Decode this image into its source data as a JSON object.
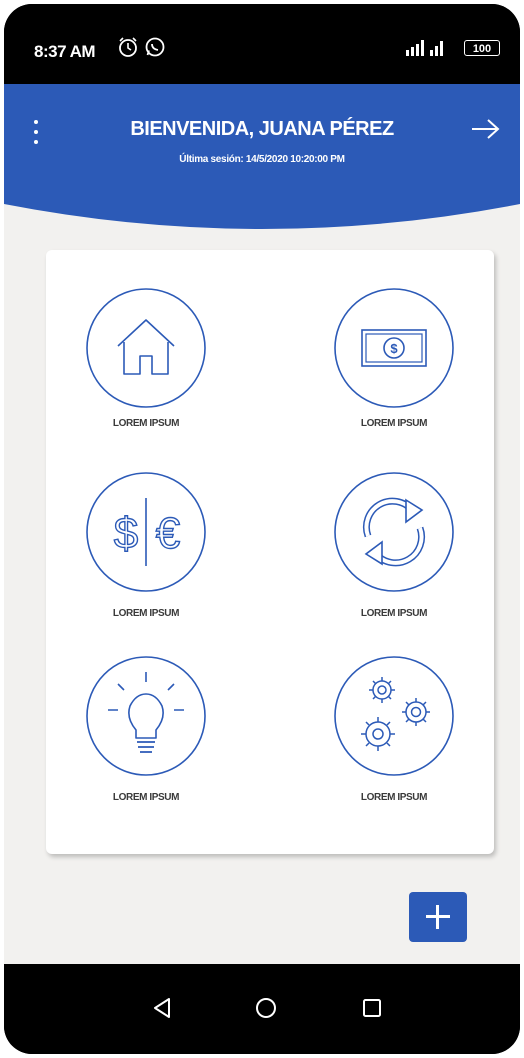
{
  "status_bar": {
    "time": "8:37 AM",
    "battery": "100",
    "icons": [
      "alarm-icon",
      "whatsapp-icon",
      "signal-icon",
      "battery-icon"
    ]
  },
  "header": {
    "title": "BIENVENIDA, JUANA PÉREZ",
    "subtitle": "Última sesión: 14/5/2020 10:20:00 PM",
    "background_color": "#2c5ab7",
    "icons": [
      "more-vert-icon",
      "logout-arrow-icon"
    ]
  },
  "grid": {
    "accent_color": "#2c5ab7",
    "items": [
      {
        "label": "LOREM IPSUM",
        "icon": "home-icon"
      },
      {
        "label": "LOREM IPSUM",
        "icon": "money-bill-icon"
      },
      {
        "label": "LOREM IPSUM",
        "icon": "currency-exchange-icon"
      },
      {
        "label": "LOREM IPSUM",
        "icon": "refresh-arrows-icon"
      },
      {
        "label": "LOREM IPSUM",
        "icon": "lightbulb-icon"
      },
      {
        "label": "LOREM IPSUM",
        "icon": "gears-icon"
      }
    ]
  },
  "fab": {
    "icon": "plus-icon",
    "color": "#2c5ab7"
  },
  "nav_bar": {
    "icons": [
      "back-triangle-icon",
      "home-circle-icon",
      "recents-square-icon"
    ]
  }
}
